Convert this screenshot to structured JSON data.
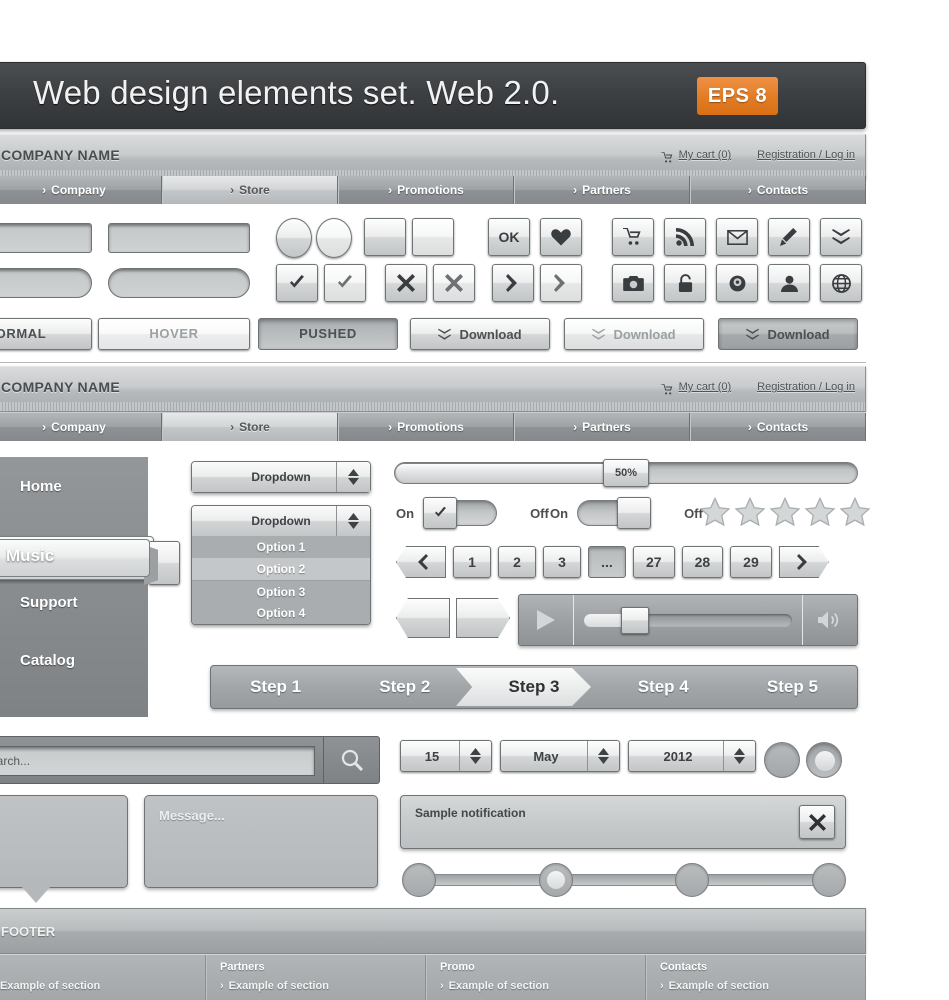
{
  "title": {
    "text": "Web design elements set. Web 2.0.",
    "badge": "EPS 8"
  },
  "header": {
    "company_name": "COMPANY NAME",
    "cart_label": "My cart (0)",
    "account_label": "Registration / Log in",
    "cart_icon": "shopping-cart-icon"
  },
  "nav": {
    "caret": "›",
    "items": [
      {
        "label": "Company",
        "active": false
      },
      {
        "label": "Store",
        "active": true
      },
      {
        "label": "Promotions",
        "active": false
      },
      {
        "label": "Partners",
        "active": false
      },
      {
        "label": "Contacts",
        "active": false
      }
    ]
  },
  "buttons": {
    "ok_label": "OK",
    "states": [
      {
        "label": "NORMAL",
        "state": "normal"
      },
      {
        "label": "HOVER",
        "state": "hover"
      },
      {
        "label": "PUSHED",
        "state": "pushed"
      }
    ],
    "download_label": "Download",
    "download_icon": "chevron-double-down-icon",
    "icons_row1": [
      "shopping-cart-icon",
      "rss-icon",
      "envelope-icon",
      "pencil-icon",
      "chevron-double-down-icon"
    ],
    "icons_row2": [
      "camera-icon",
      "lock-icon",
      "eye-icon",
      "user-icon",
      "globe-icon"
    ]
  },
  "sidebar": {
    "items": [
      {
        "label": "Home",
        "active": false
      },
      {
        "label": "Music",
        "active": true
      },
      {
        "label": "Support",
        "active": false
      },
      {
        "label": "Catalog",
        "active": false
      }
    ]
  },
  "dropdowns": {
    "label": "Dropdown",
    "options": [
      {
        "label": "Option 1",
        "highlight": false
      },
      {
        "label": "Option 2",
        "highlight": true
      },
      {
        "label": "Option 3",
        "highlight": false
      },
      {
        "label": "Option 4",
        "highlight": false
      }
    ]
  },
  "slider": {
    "value_label": "50%",
    "percent": 50
  },
  "toggles": [
    {
      "on_label": "On",
      "off_label": "Off",
      "checked": true
    },
    {
      "on_label": "On",
      "off_label": "Off",
      "checked": false
    }
  ],
  "rating": {
    "stars": 5,
    "filled": 0
  },
  "pagination": {
    "prev_icon": "arrow-left-icon",
    "next_icon": "arrow-right-icon",
    "pages": [
      "1",
      "2",
      "3",
      "...",
      "27",
      "28",
      "29"
    ],
    "current": "..."
  },
  "player": {
    "play_icon": "play-icon",
    "volume_icon": "speaker-icon",
    "progress": 22
  },
  "steps": [
    {
      "label": "Step 1",
      "active": false
    },
    {
      "label": "Step 2",
      "active": false
    },
    {
      "label": "Step 3",
      "active": true
    },
    {
      "label": "Step 4",
      "active": false
    },
    {
      "label": "Step 5",
      "active": false
    }
  ],
  "date_picker": {
    "day": "15",
    "month": "May",
    "year": "2012"
  },
  "notification": {
    "text": "Sample notification",
    "close_icon": "close-icon"
  },
  "carousel": {
    "dots": 4,
    "active_index": 1
  },
  "search": {
    "placeholder": "Search...",
    "icon": "search-icon"
  },
  "message_box": {
    "placeholder": "Message..."
  },
  "footer": {
    "title": "FOOTER",
    "caret": "›",
    "columns": [
      {
        "title": "",
        "link": "Example of section"
      },
      {
        "title": "Partners",
        "link": "Example of section"
      },
      {
        "title": "Promo",
        "link": "Example of section"
      },
      {
        "title": "Contacts",
        "link": "Example of section"
      }
    ]
  }
}
